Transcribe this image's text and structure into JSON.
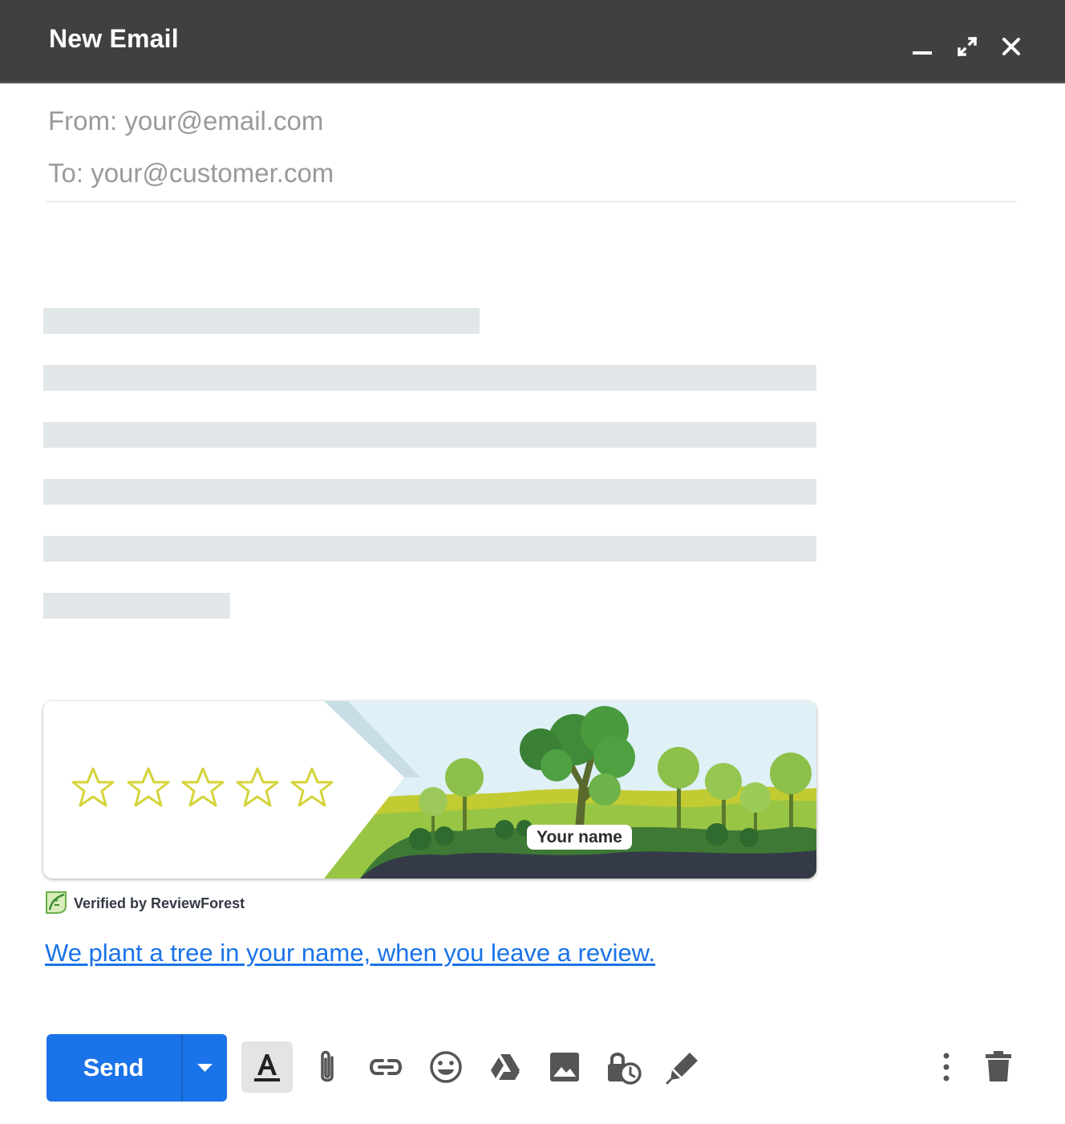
{
  "window": {
    "title": "New Email",
    "controls": [
      "minimize-icon",
      "expand-icon",
      "close-icon"
    ]
  },
  "header": {
    "from": "From: your@email.com",
    "to": "To: your@customer.com"
  },
  "banner": {
    "stars_total": 5,
    "stars_filled": 0,
    "star_color": "#d4d43a",
    "name_label": "Your name"
  },
  "verified": {
    "text": "Verified by ReviewForest",
    "icon": "leaf-icon"
  },
  "link": {
    "text": "We plant a tree in your name, when you leave a review."
  },
  "toolbar": {
    "send_label": "Send",
    "accent": "#1a73e8",
    "icons": [
      "formatting-icon",
      "attach-icon",
      "link-icon",
      "emoji-icon",
      "drive-icon",
      "photo-icon",
      "confidential-icon",
      "signature-icon",
      "more-options-icon",
      "delete-icon"
    ]
  }
}
